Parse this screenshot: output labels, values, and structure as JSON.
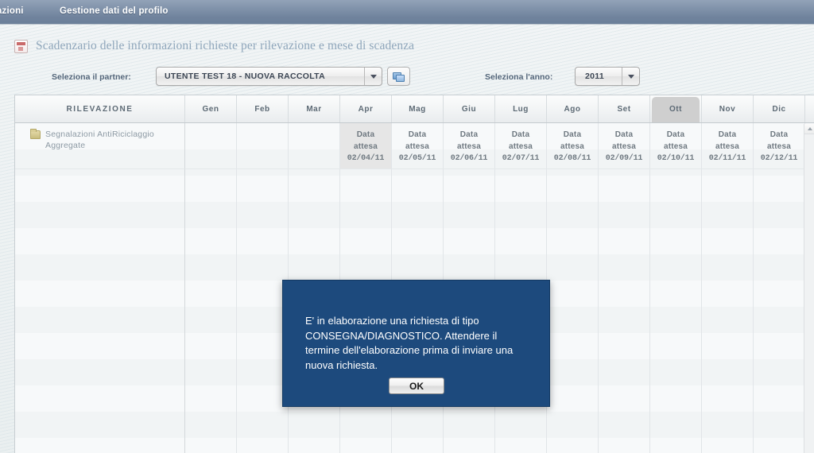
{
  "topnav": {
    "items": [
      {
        "label": "zzazioni"
      },
      {
        "label": "Gestione dati del profilo"
      }
    ]
  },
  "header": {
    "title": "Scadenzario delle informazioni richieste per rilevazione e mese di scadenza",
    "title_icon": "calendar-icon"
  },
  "filters": {
    "partner_label": "Seleziona il partner:",
    "partner_value": "UTENTE TEST 18 - NUOVA RACCOLTA",
    "refresh_icon": "refresh-icon",
    "year_label": "Seleziona l'anno:",
    "year_value": "2011"
  },
  "grid": {
    "columns": [
      {
        "key": "rilevazione",
        "label": "RILEVAZIONE",
        "selected": false
      },
      {
        "key": "gen",
        "label": "Gen",
        "selected": false
      },
      {
        "key": "feb",
        "label": "Feb",
        "selected": false
      },
      {
        "key": "mar",
        "label": "Mar",
        "selected": false
      },
      {
        "key": "apr",
        "label": "Apr",
        "selected": false
      },
      {
        "key": "mag",
        "label": "Mag",
        "selected": false
      },
      {
        "key": "giu",
        "label": "Giu",
        "selected": false
      },
      {
        "key": "lug",
        "label": "Lug",
        "selected": false
      },
      {
        "key": "ago",
        "label": "Ago",
        "selected": false
      },
      {
        "key": "set",
        "label": "Set",
        "selected": false
      },
      {
        "key": "ott",
        "label": "Ott",
        "selected": true
      },
      {
        "key": "nov",
        "label": "Nov",
        "selected": false
      },
      {
        "key": "dic",
        "label": "Dic",
        "selected": false
      }
    ],
    "rows": [
      {
        "label": "Segnalazioni AntiRiciclaggio Aggregate",
        "icon": "folder-icon",
        "cells": [
          {
            "month": "gen",
            "waiting_label": "",
            "date": "",
            "empty": true,
            "hover": false
          },
          {
            "month": "feb",
            "waiting_label": "",
            "date": "",
            "empty": true,
            "hover": false
          },
          {
            "month": "mar",
            "waiting_label": "",
            "date": "",
            "empty": true,
            "hover": false
          },
          {
            "month": "apr",
            "waiting_label": "Data attesa",
            "date": "02/04/11",
            "empty": false,
            "hover": true
          },
          {
            "month": "mag",
            "waiting_label": "Data attesa",
            "date": "02/05/11",
            "empty": false,
            "hover": false
          },
          {
            "month": "giu",
            "waiting_label": "Data attesa",
            "date": "02/06/11",
            "empty": false,
            "hover": false
          },
          {
            "month": "lug",
            "waiting_label": "Data attesa",
            "date": "02/07/11",
            "empty": false,
            "hover": false
          },
          {
            "month": "ago",
            "waiting_label": "Data attesa",
            "date": "02/08/11",
            "empty": false,
            "hover": false
          },
          {
            "month": "set",
            "waiting_label": "Data attesa",
            "date": "02/09/11",
            "empty": false,
            "hover": false
          },
          {
            "month": "ott",
            "waiting_label": "Data attesa",
            "date": "02/10/11",
            "empty": false,
            "hover": false
          },
          {
            "month": "nov",
            "waiting_label": "Data attesa",
            "date": "02/11/11",
            "empty": false,
            "hover": false
          },
          {
            "month": "dic",
            "waiting_label": "Data attesa",
            "date": "02/12/11",
            "empty": false,
            "hover": false
          }
        ]
      }
    ]
  },
  "dialog": {
    "message": "E' in elaborazione una richiesta di tipo CONSEGNA/DIAGNOSTICO. Attendere il termine dell'elaborazione prima di inviare una nuova richiesta.",
    "ok_label": "OK",
    "background_color": "#1d4a7d"
  }
}
